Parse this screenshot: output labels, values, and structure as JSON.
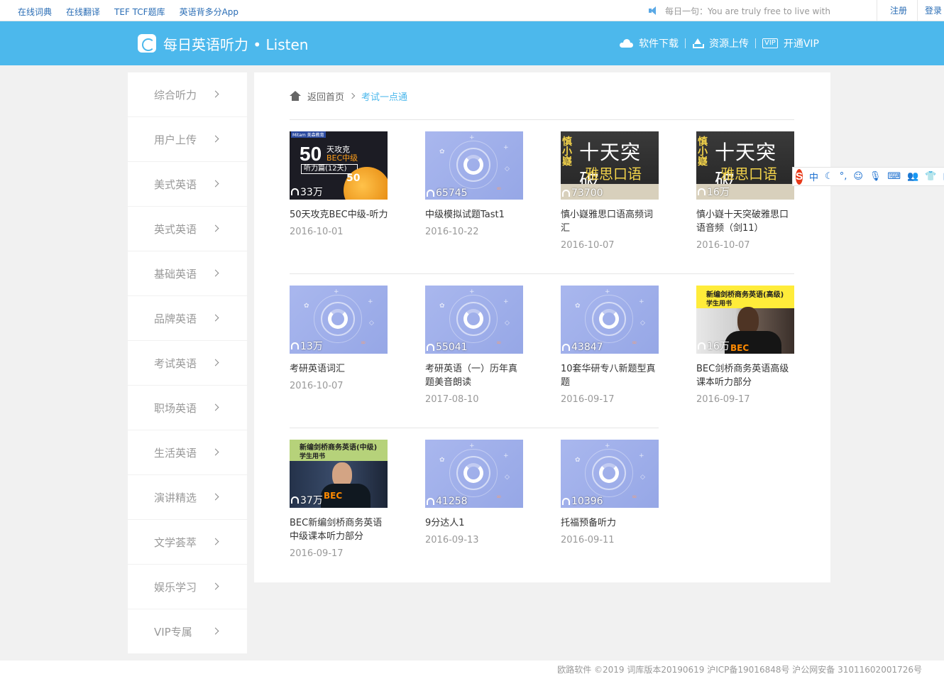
{
  "topbar": {
    "links": [
      "在线词典",
      "在线翻译",
      "TEF TCF题库",
      "英语背多分App"
    ],
    "daily_text": "每日一句：You are truly free to live with",
    "register": "注册",
    "login": "登录"
  },
  "header": {
    "title": "每日英语听力 • Listen",
    "nav": [
      {
        "label": "软件下载",
        "icon": "cloud-download-icon"
      },
      {
        "label": "资源上传",
        "icon": "upload-icon"
      },
      {
        "label": "开通VIP",
        "icon": "vip-icon",
        "badge": "VIP"
      }
    ]
  },
  "sidebar": {
    "items": [
      "综合听力",
      "用户上传",
      "美式英语",
      "英式英语",
      "基础英语",
      "品牌英语",
      "考试英语",
      "职场英语",
      "生活英语",
      "演讲精选",
      "文学荟萃",
      "娱乐学习",
      "VIP专属"
    ]
  },
  "breadcrumb": {
    "home": "返回首页",
    "current": "考试一点通"
  },
  "items": [
    {
      "title": "50天攻克BEC中级-听力",
      "date": "2016-10-01",
      "count": "33万",
      "cover": "bec50"
    },
    {
      "title": "中级模拟试题Tast1",
      "date": "2016-10-22",
      "count": "65745",
      "cover": "default"
    },
    {
      "title": "慎小嶷雅思口语高频词汇",
      "date": "2016-10-07",
      "count": "73700",
      "cover": "yasi"
    },
    {
      "title": "慎小嶷十天突破雅思口语音频（剑11）",
      "date": "2016-10-07",
      "count": "16万",
      "cover": "yasi"
    },
    {
      "title": "考研英语词汇",
      "date": "2016-10-07",
      "count": "13万",
      "cover": "default"
    },
    {
      "title": "考研英语（一）历年真题美音朗读",
      "date": "2017-08-10",
      "count": "55041",
      "cover": "default"
    },
    {
      "title": "10套华研专八新题型真题",
      "date": "2016-09-17",
      "count": "43847",
      "cover": "default"
    },
    {
      "title": "BEC剑桥商务英语高级课本听力部分",
      "date": "2016-09-17",
      "count": "16万",
      "cover": "bec-hi"
    },
    {
      "title": "BEC新编剑桥商务英语中级课本听力部分",
      "date": "2016-09-17",
      "count": "37万",
      "cover": "bec-mid"
    },
    {
      "title": "9分达人1",
      "date": "2016-09-13",
      "count": "41258",
      "cover": "default"
    },
    {
      "title": "托福预备听力",
      "date": "2016-09-11",
      "count": "10396",
      "cover": "default"
    }
  ],
  "covers": {
    "bec50": {
      "big": "50",
      "line1": "天攻克",
      "line2": "BEC中级",
      "bar": "听力篇(12天)",
      "disc": "50",
      "tag": "Mitam 美森教育"
    },
    "yasi": {
      "side": "慎小嶷",
      "line1": "十天突破",
      "line2": "雅思口语"
    },
    "bec_hi": {
      "line1": "新编剑桥商务英语(高级)",
      "line2": "学生用书",
      "mark": "BEC"
    },
    "bec_mid": {
      "line1": "新编剑桥商务英语(中级)",
      "line2": "学生用书",
      "mark": "BEC"
    }
  },
  "ime": {
    "logo": "S",
    "mode": "中"
  },
  "footer": "欧路软件 ©2019 词库版本20190619 沪ICP备19016848号 沪公网安备 31011602001726号",
  "colors": {
    "header": "#4cb8ec",
    "link": "#2a6db5",
    "accent": "#4cb8ec"
  }
}
